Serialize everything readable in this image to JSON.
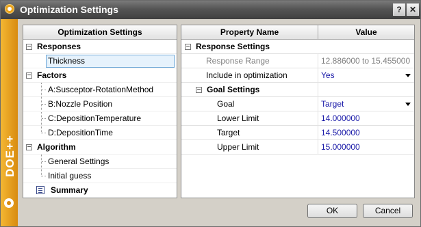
{
  "window": {
    "title": "Optimization Settings",
    "help_label": "?",
    "close_label": "✕"
  },
  "brand": {
    "text": "DOE++"
  },
  "tree": {
    "header": "Optimization Settings",
    "responses": {
      "label": "Responses",
      "items": [
        "Thickness"
      ]
    },
    "factors": {
      "label": "Factors",
      "items": [
        "A:Susceptor-RotationMethod",
        "B:Nozzle Position",
        "C:DepositionTemperature",
        "D:DepositionTime"
      ]
    },
    "algorithm": {
      "label": "Algorithm",
      "items": [
        "General Settings",
        "Initial guess"
      ]
    },
    "summary": {
      "label": "Summary"
    }
  },
  "props": {
    "col_name": "Property Name",
    "col_value": "Value",
    "section": "Response Settings",
    "response_range": {
      "name": "Response Range",
      "value": "12.886000 to 15.455000"
    },
    "include": {
      "name": "Include in optimization",
      "value": "Yes"
    },
    "goal_section": "Goal Settings",
    "goal": {
      "name": "Goal",
      "value": "Target"
    },
    "lower": {
      "name": "Lower Limit",
      "value": "14.000000"
    },
    "target": {
      "name": "Target",
      "value": "14.500000"
    },
    "upper": {
      "name": "Upper Limit",
      "value": "15.000000"
    }
  },
  "buttons": {
    "ok": "OK",
    "cancel": "Cancel"
  },
  "colors": {
    "sidebar": "#e8a21c",
    "value_blue": "#1a1aa8",
    "selection": "#e6f2fc"
  }
}
